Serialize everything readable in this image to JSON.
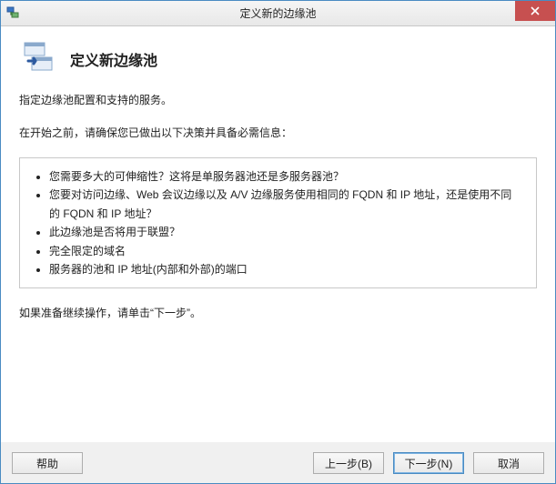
{
  "window": {
    "title": "定义新的边缘池"
  },
  "header": {
    "heading": "定义新边缘池"
  },
  "content": {
    "p1": "指定边缘池配置和支持的服务。",
    "p2": "在开始之前，请确保您已做出以下决策并具备必需信息：",
    "bullets": [
      "您需要多大的可伸缩性？这将是单服务器池还是多服务器池？",
      "您要对访问边缘、Web 会议边缘以及 A/V 边缘服务使用相同的 FQDN 和 IP 地址，还是使用不同的 FQDN 和 IP 地址？",
      "此边缘池是否将用于联盟？",
      "完全限定的域名",
      "服务器的池和 IP 地址(内部和外部)的端口"
    ],
    "p3": "如果准备继续操作，请单击“下一步”。"
  },
  "buttons": {
    "help": "帮助",
    "back": "上一步(B)",
    "next": "下一步(N)",
    "cancel": "取消"
  }
}
